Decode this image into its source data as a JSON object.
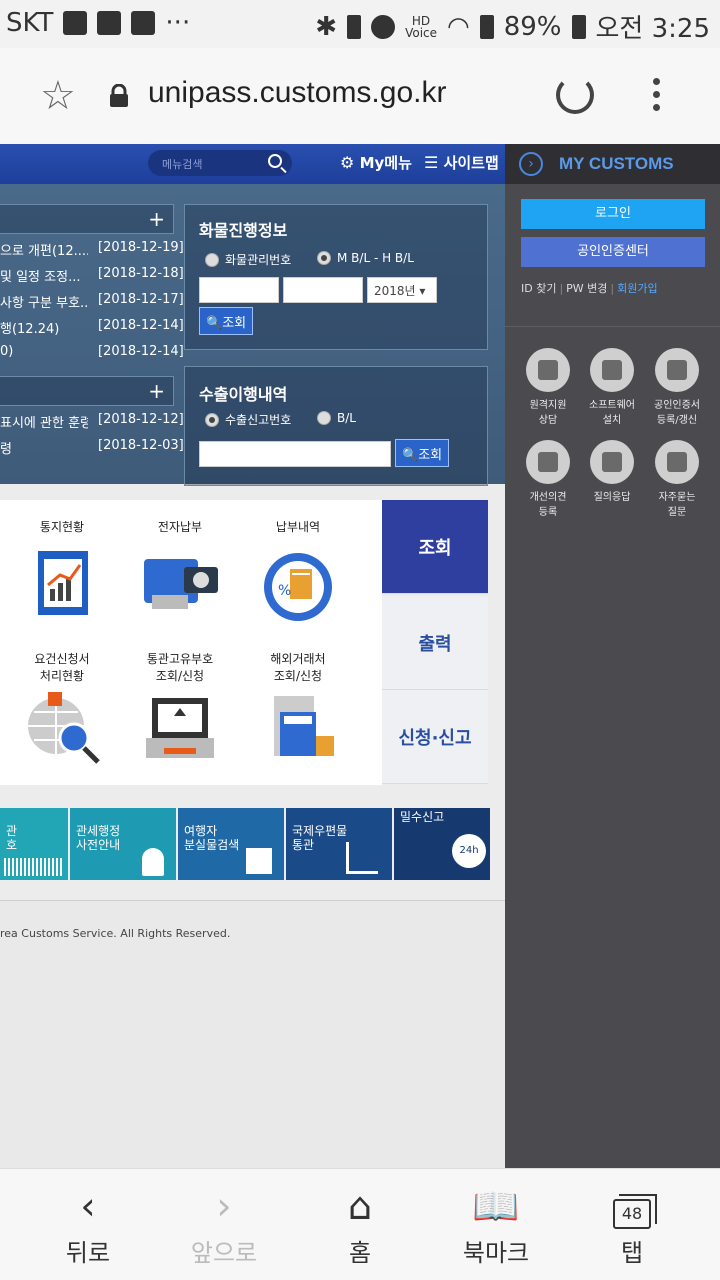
{
  "status": {
    "carrier": "SKT",
    "battery": "89%",
    "time": "오전 3:25",
    "hd_top": "HD",
    "hd_bottom": "Voice"
  },
  "browser": {
    "url": "unipass.customs.go.kr",
    "nav": {
      "back": "뒤로",
      "forward": "앞으로",
      "home": "홈",
      "bookmarks": "북마크",
      "tabs": "탭",
      "tab_count": "48"
    }
  },
  "site": {
    "search_placeholder": "메뉴검색",
    "mymenu": "My메뉴",
    "sitemap": "사이트맵",
    "notices": [
      {
        "title": "으로 개편(12....",
        "date": "[2018-12-19]"
      },
      {
        "title": "및 일정 조정...",
        "date": "[2018-12-18]"
      },
      {
        "title": "사항 구분 부호...",
        "date": "[2018-12-17]"
      },
      {
        "title": "행(12.24)",
        "date": "[2018-12-14]"
      },
      {
        "title": "0)",
        "date": "[2018-12-14]"
      }
    ],
    "notices2": [
      {
        "title": "표시에 관한 훈령",
        "date": "[2018-12-12]"
      },
      {
        "title": "령",
        "date": "[2018-12-03]"
      }
    ],
    "cargo": {
      "title": "화물진행정보",
      "radio1": "화물관리번호",
      "radio2": "M B/L - H B/L",
      "year": "2018년 ▾",
      "search": "조회"
    },
    "export": {
      "title": "수출이행내역",
      "radio1": "수출신고번호",
      "radio2": "B/L",
      "search": "조회"
    },
    "services": [
      {
        "label": "통지현황"
      },
      {
        "label": "전자납부"
      },
      {
        "label": "납부내역"
      },
      {
        "label": "요건신청서\n처리현황"
      },
      {
        "label": "통관고유부호\n조회/신청"
      },
      {
        "label": "해외거래처\n조회/신청"
      }
    ],
    "tabs": [
      "조회",
      "출력",
      "신청·신고"
    ],
    "quick": [
      {
        "label": "관\n호",
        "sub": "BARCODE"
      },
      {
        "label": "관세행정\n사전안내"
      },
      {
        "label": "여행자\n분실물검색"
      },
      {
        "label": "국제우편물\n통관"
      },
      {
        "label": "밀수신고",
        "sub": "24h"
      }
    ],
    "footer": "rea Customs Service. All Rights Reserved."
  },
  "mycustoms": {
    "title": "MY CUSTOMS",
    "login": "로그인",
    "cert_center": "공인인증센터",
    "find_id": "ID 찾기",
    "pw_change": "PW 변경",
    "signup": "회원가입",
    "icons": [
      {
        "label": "원격지원\n상담"
      },
      {
        "label": "소프트웨어\n설치"
      },
      {
        "label": "공인인증서\n등록/갱신"
      },
      {
        "label": "개선의견\n등록"
      },
      {
        "label": "질의응답"
      },
      {
        "label": "자주묻는\n질문"
      }
    ]
  },
  "colors": {
    "brand_blue": "#2e3fa0",
    "login_blue": "#1ea4f2",
    "panel_dark": "#4a4a4f"
  }
}
